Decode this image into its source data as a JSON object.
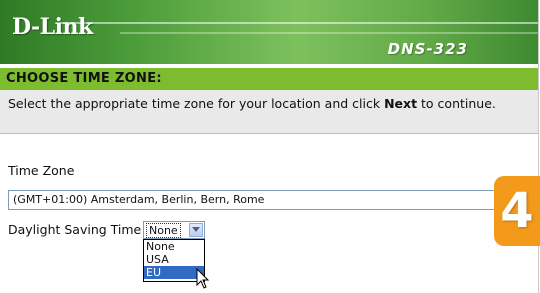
{
  "header": {
    "brand": "D-Link",
    "model": "DNS-323"
  },
  "section": {
    "title": "CHOOSE TIME ZONE:"
  },
  "instructions": {
    "text_before": "Select the appropriate time zone for your location and click ",
    "bold_word": "Next",
    "text_after": " to continue."
  },
  "time_zone": {
    "label": "Time Zone",
    "value": "(GMT+01:00) Amsterdam, Berlin, Bern, Rome"
  },
  "dst": {
    "label": "Daylight Saving Time",
    "value": "None",
    "options": [
      "None",
      "USA",
      "EU"
    ],
    "highlighted": "EU"
  },
  "step_badge": {
    "number": "4",
    "color": "#f39a1b"
  },
  "colors": {
    "header_green": "#4c9d3a",
    "title_bar": "#7cbc2e",
    "selection": "#316ac5"
  }
}
